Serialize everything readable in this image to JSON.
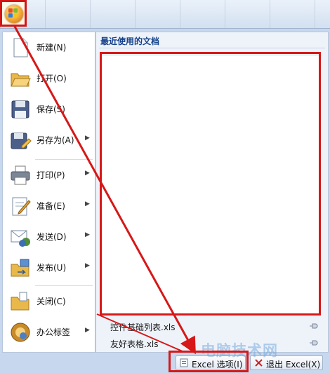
{
  "menu": {
    "items": [
      {
        "label": "新建(N)",
        "icon": "new-document-icon",
        "submenu": false
      },
      {
        "label": "打开(O)",
        "icon": "open-folder-icon",
        "submenu": false
      },
      {
        "label": "保存(S)",
        "icon": "save-disk-icon",
        "submenu": false
      },
      {
        "label": "另存为(A)",
        "icon": "save-as-icon",
        "submenu": true
      },
      {
        "label": "打印(P)",
        "icon": "printer-icon",
        "submenu": true
      },
      {
        "label": "准备(E)",
        "icon": "prepare-icon",
        "submenu": true
      },
      {
        "label": "发送(D)",
        "icon": "send-icon",
        "submenu": true
      },
      {
        "label": "发布(U)",
        "icon": "publish-icon",
        "submenu": true
      },
      {
        "label": "关闭(C)",
        "icon": "close-folder-icon",
        "submenu": false
      },
      {
        "label": "办公标签",
        "icon": "office-tab-icon",
        "submenu": true
      }
    ]
  },
  "recent": {
    "title": "最近使用的文档",
    "files": [
      "控件基础列表.xls",
      "友好表格.xls"
    ]
  },
  "buttons": {
    "options": "Excel 选项(I)",
    "exit": "退出 Excel(X)"
  },
  "watermark": "电脑技术网",
  "colors": {
    "annotation": "#d61818",
    "accent": "#15428b"
  }
}
